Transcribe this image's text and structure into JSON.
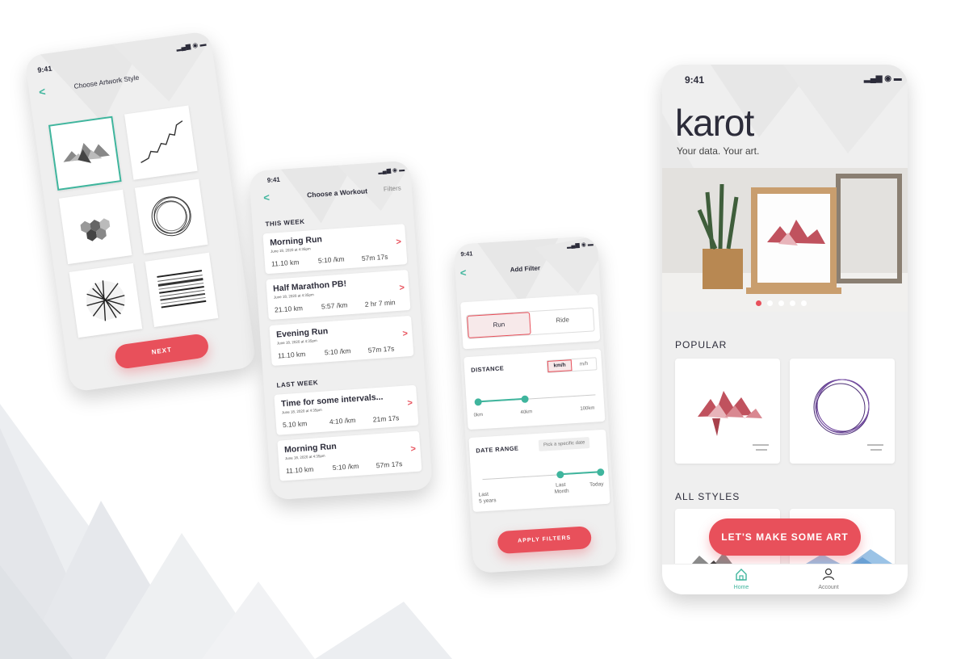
{
  "colors": {
    "accent_red": "#e8505b",
    "accent_teal": "#3fb59d",
    "background_mountain": "#e4e6ea"
  },
  "screen_style": {
    "status_time": "9:41",
    "title": "Choose Artwork Style",
    "styles": [
      "mountain-chart",
      "line-path",
      "hexagons",
      "circles",
      "network",
      "stripes"
    ],
    "next_label": "NEXT"
  },
  "screen_workout": {
    "status_time": "9:41",
    "title": "Choose a Workout",
    "filters_label": "Filters",
    "sections": [
      {
        "heading": "THIS WEEK",
        "workouts": [
          {
            "name": "Morning Run",
            "date": "June 18, 2020 at 4:35pm",
            "distance": "11.10 km",
            "pace": "5:10  /km",
            "duration": "57m 17s"
          },
          {
            "name": "Half Marathon PB!",
            "date": "June 18, 2020 at 4:35pm",
            "distance": "21.10 km",
            "pace": "5:57  /km",
            "duration": "2 hr 7 min"
          },
          {
            "name": "Evening Run",
            "date": "June 18, 2020 at 4:35pm",
            "distance": "11.10 km",
            "pace": "5:10  /km",
            "duration": "57m 17s"
          }
        ]
      },
      {
        "heading": "LAST WEEK",
        "workouts": [
          {
            "name": "Time for some intervals...",
            "date": "June 18, 2020 at 4:35pm",
            "distance": "5.10 km",
            "pace": "4:10  /km",
            "duration": "21m 17s"
          },
          {
            "name": "Morning Run",
            "date": "June 18, 2020 at 4:35pm",
            "distance": "11.10 km",
            "pace": "5:10  /km",
            "duration": "57m 17s"
          }
        ]
      }
    ]
  },
  "screen_filter": {
    "status_time": "9:41",
    "title": "Add Filter",
    "activity_options": [
      "Run",
      "Ride"
    ],
    "activity_selected": "Run",
    "distance": {
      "label": "DISTANCE",
      "units": [
        "km/h",
        "m/h"
      ],
      "unit_selected": "km/h",
      "ticks": [
        "0km",
        "40km",
        "100km"
      ],
      "range_fraction": [
        0.0,
        0.4
      ]
    },
    "date_range": {
      "label": "DATE RANGE",
      "pick_label": "Pick a specific date",
      "ticks_start": [
        "Last",
        "5 years"
      ],
      "ticks_mid": [
        "Last",
        "Month"
      ],
      "tick_end": "Today",
      "range_fraction": [
        0.66,
        1.0
      ]
    },
    "apply_label": "APPLY FILTERS"
  },
  "screen_home": {
    "status_time": "9:41",
    "logo": "karot",
    "tagline": "Your data. Your art.",
    "carousel": {
      "count": 5,
      "active_index": 0
    },
    "popular_heading": "POPULAR",
    "all_styles_heading": "ALL STYLES",
    "cta_label": "LET'S MAKE SOME ART",
    "nav": [
      {
        "label": "Home",
        "icon": "home-icon",
        "active": true
      },
      {
        "label": "Account",
        "icon": "account-icon",
        "active": false
      }
    ]
  }
}
